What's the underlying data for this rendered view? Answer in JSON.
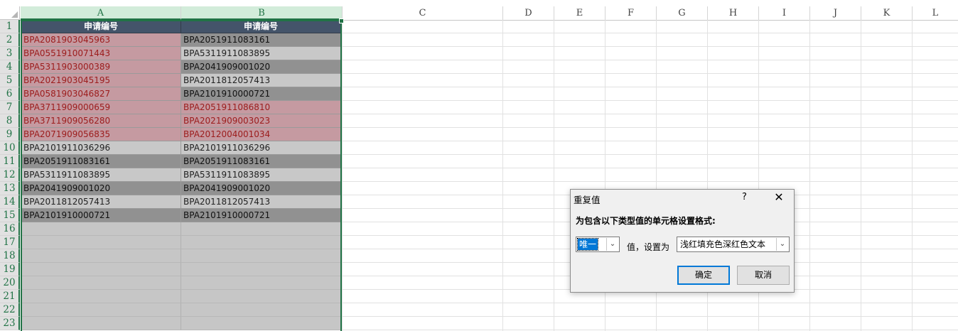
{
  "columns": [
    "A",
    "B",
    "C",
    "D",
    "E",
    "F",
    "G",
    "H",
    "I",
    "J",
    "K",
    "L"
  ],
  "rows": [
    "1",
    "2",
    "3",
    "4",
    "5",
    "6",
    "7",
    "8",
    "9",
    "10",
    "11",
    "12",
    "13",
    "14",
    "15",
    "16",
    "17",
    "18",
    "19",
    "20",
    "21",
    "22",
    "23"
  ],
  "table": {
    "header_a": "申请编号",
    "header_b": "申请编号",
    "col_a": [
      {
        "value": "BPA2081903045963",
        "style": "dup"
      },
      {
        "value": "BPA0551910071443",
        "style": "dup"
      },
      {
        "value": "BPA5311903000389",
        "style": "dup"
      },
      {
        "value": "BPA2021903045195",
        "style": "dup"
      },
      {
        "value": "BPA0581903046827",
        "style": "dup"
      },
      {
        "value": "BPA3711909000659",
        "style": "dup"
      },
      {
        "value": "BPA3711909056280",
        "style": "dup"
      },
      {
        "value": "BPA2071909056835",
        "style": "dup"
      },
      {
        "value": "BPA2101911036296",
        "style": "light"
      },
      {
        "value": "BPA2051911083161",
        "style": "dark"
      },
      {
        "value": "BPA5311911083895",
        "style": "light"
      },
      {
        "value": "BPA2041909001020",
        "style": "dark"
      },
      {
        "value": "BPA2011812057413",
        "style": "light"
      },
      {
        "value": "BPA2101910000721",
        "style": "dark"
      }
    ],
    "col_b": [
      {
        "value": "BPA2051911083161",
        "style": "dark"
      },
      {
        "value": "BPA5311911083895",
        "style": "light"
      },
      {
        "value": "BPA2041909001020",
        "style": "dark"
      },
      {
        "value": "BPA2011812057413",
        "style": "light"
      },
      {
        "value": "BPA2101910000721",
        "style": "dark"
      },
      {
        "value": "BPA2051911086810",
        "style": "dup"
      },
      {
        "value": "BPA2021909003023",
        "style": "dup"
      },
      {
        "value": "BPA2012004001034",
        "style": "dup"
      },
      {
        "value": "BPA2101911036296",
        "style": "light"
      },
      {
        "value": "BPA2051911083161",
        "style": "dark"
      },
      {
        "value": "BPA5311911083895",
        "style": "light"
      },
      {
        "value": "BPA2041909001020",
        "style": "dark"
      },
      {
        "value": "BPA2011812057413",
        "style": "light"
      },
      {
        "value": "BPA2101910000721",
        "style": "dark"
      }
    ]
  },
  "dialog": {
    "title": "重复值",
    "help": "?",
    "close": "✕",
    "prompt": "为包含以下类型值的单元格设置格式:",
    "type_value": "唯一",
    "middle_label": "值，设置为",
    "format_value": "浅红填充色深红色文本",
    "ok_label": "确定",
    "cancel_label": "取消"
  },
  "colors": {
    "accent": "#217346",
    "header_fill": "#44546a",
    "dup_fill": "#c59aa1",
    "dup_text": "#9c1c1c",
    "button_focus": "#0078d7"
  }
}
